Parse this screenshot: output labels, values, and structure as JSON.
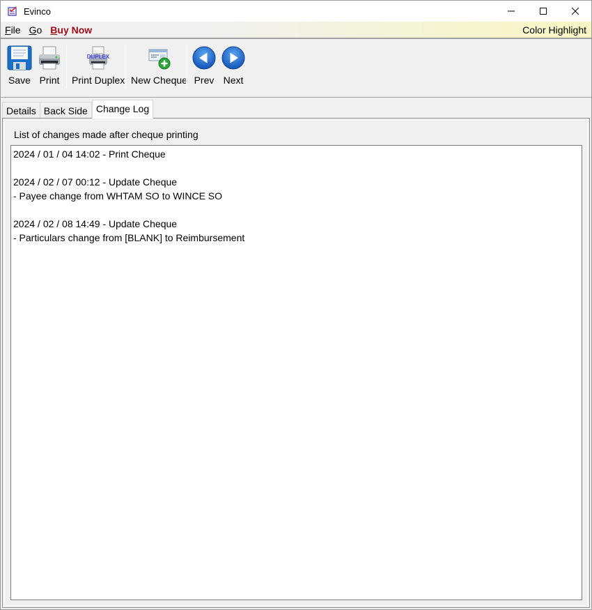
{
  "window": {
    "title": "Evinco",
    "controls": {
      "minimize": "minimize",
      "maximize": "maximize",
      "close": "close"
    }
  },
  "menubar": {
    "items": [
      {
        "label": "File",
        "accel": "F",
        "rest": "ile"
      },
      {
        "label": "Go",
        "accel": "G",
        "rest": "o"
      },
      {
        "label": "Buy Now",
        "accel": "B",
        "rest": "uy Now"
      }
    ],
    "right_label": "Color Highlight"
  },
  "toolbar": {
    "buttons": [
      {
        "label": "Save",
        "icon": "floppy-disk-icon"
      },
      {
        "label": "Print",
        "icon": "printer-icon"
      },
      {
        "label": "Print Duplex",
        "icon": "duplex-printer-icon",
        "icon_text": "DUPLEX"
      },
      {
        "label": "New Cheque",
        "icon": "new-cheque-icon"
      },
      {
        "label": "Prev",
        "icon": "arrow-left-circle-icon"
      },
      {
        "label": "Next",
        "icon": "arrow-right-circle-icon"
      }
    ]
  },
  "tabs": [
    {
      "label": "Details",
      "active": false
    },
    {
      "label": "Back Side",
      "active": false
    },
    {
      "label": "Change Log",
      "active": true
    }
  ],
  "change_log": {
    "heading": "List of changes made after cheque printing",
    "lines": [
      "2024 / 01 / 04 14:02 - Print Cheque",
      "",
      "2024 / 02 / 07 00:12 - Update Cheque",
      "- Payee change from WHTAM SO to WINCE SO",
      "",
      "2024 / 02 / 08 14:49 - Update Cheque",
      "- Particulars change from [BLANK] to Reimbursement"
    ]
  },
  "colors": {
    "buy_now": "#a00b16",
    "menubar_highlight": "#f8f6c4",
    "nav_blue": "#1f6fd6"
  }
}
